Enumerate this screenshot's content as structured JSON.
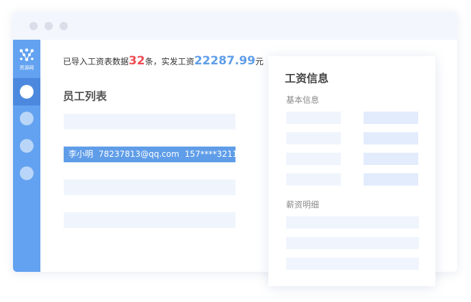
{
  "summary": {
    "prefix": "已导入工资表数据",
    "record_count": "32",
    "records_unit": "条，实发工资",
    "total_salary": "22287.99",
    "currency": "元"
  },
  "sidebar": {
    "logo_text": "资源网"
  },
  "employee_list": {
    "title": "员工列表",
    "selected_row": {
      "name": "李小明",
      "email": "78237813@qq.com",
      "phone": "157****3211"
    }
  },
  "salary_card": {
    "title": "工资信息",
    "basic_info_label": "基本信息",
    "salary_detail_label": "薪资明细"
  },
  "colors": {
    "accent": "#63a2f0",
    "accent_dark": "#4c89de",
    "highlight_red": "#ef4b52",
    "highlight_blue": "#5f9de8"
  }
}
